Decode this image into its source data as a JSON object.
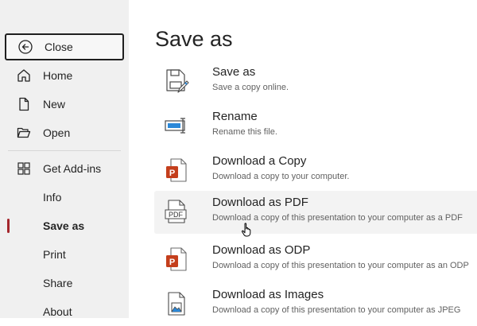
{
  "sidebar": {
    "close_label": "Close",
    "items": [
      {
        "label": "Home",
        "icon": "home-icon"
      },
      {
        "label": "New",
        "icon": "new-document-icon"
      },
      {
        "label": "Open",
        "icon": "open-folder-icon"
      },
      {
        "label": "Get Add-ins",
        "icon": "add-ins-grid-icon"
      },
      {
        "label": "Info"
      },
      {
        "label": "Save as",
        "active": true
      },
      {
        "label": "Print"
      },
      {
        "label": "Share"
      },
      {
        "label": "About"
      }
    ],
    "active_color": "#a4262c"
  },
  "main": {
    "title": "Save as",
    "options": [
      {
        "title": "Save as",
        "desc": "Save a copy online.",
        "icon": "save-as-icon"
      },
      {
        "title": "Rename",
        "desc": "Rename this file.",
        "icon": "rename-icon"
      },
      {
        "title": "Download a Copy",
        "desc": "Download a copy to your computer.",
        "icon": "powerpoint-file-icon"
      },
      {
        "title": "Download as PDF",
        "desc": "Download a copy of this presentation to your computer as a PDF",
        "icon": "pdf-file-icon",
        "hovered": true
      },
      {
        "title": "Download as ODP",
        "desc": "Download a copy of this presentation to your computer as an ODP",
        "icon": "powerpoint-file-icon"
      },
      {
        "title": "Download as Images",
        "desc": "Download a copy of this presentation to your computer as JPEG",
        "icon": "image-file-icon"
      }
    ],
    "pdf_icon_text": "PDF",
    "ppt_letter": "P"
  }
}
